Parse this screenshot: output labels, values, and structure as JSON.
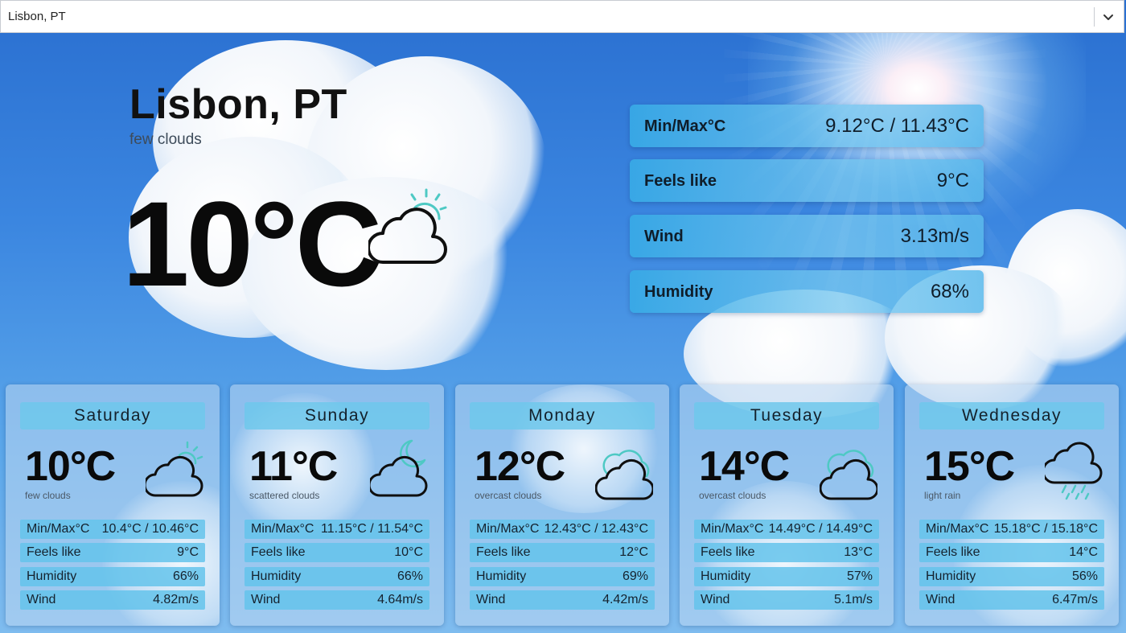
{
  "location_select": {
    "value": "Lisbon, PT"
  },
  "current": {
    "city": "Lisbon, PT",
    "description": "few clouds",
    "temperature": "10°C",
    "icon": "partly-cloudy-day-icon"
  },
  "stats": [
    {
      "label": "Min/Max°C",
      "value": "9.12°C / 11.43°C"
    },
    {
      "label": "Feels like",
      "value": "9°C"
    },
    {
      "label": "Wind",
      "value": "3.13m/s"
    },
    {
      "label": "Humidity",
      "value": "68%"
    }
  ],
  "forecast": [
    {
      "day": "Saturday",
      "temp": "10°C",
      "desc": "few clouds",
      "icon": "partly-cloudy-day-icon",
      "rows": [
        {
          "label": "Min/Max°C",
          "value": "10.4°C / 10.46°C"
        },
        {
          "label": "Feels like",
          "value": "9°C"
        },
        {
          "label": "Humidity",
          "value": "66%"
        },
        {
          "label": "Wind",
          "value": "4.82m/s"
        }
      ]
    },
    {
      "day": "Sunday",
      "temp": "11°C",
      "desc": "scattered clouds",
      "icon": "partly-cloudy-night-icon",
      "rows": [
        {
          "label": "Min/Max°C",
          "value": "11.15°C / 11.54°C"
        },
        {
          "label": "Feels like",
          "value": "10°C"
        },
        {
          "label": "Humidity",
          "value": "66%"
        },
        {
          "label": "Wind",
          "value": "4.64m/s"
        }
      ]
    },
    {
      "day": "Monday",
      "temp": "12°C",
      "desc": "overcast clouds",
      "icon": "overcast-cloud-icon",
      "rows": [
        {
          "label": "Min/Max°C",
          "value": "12.43°C / 12.43°C"
        },
        {
          "label": "Feels like",
          "value": "12°C"
        },
        {
          "label": "Humidity",
          "value": "69%"
        },
        {
          "label": "Wind",
          "value": "4.42m/s"
        }
      ]
    },
    {
      "day": "Tuesday",
      "temp": "14°C",
      "desc": "overcast clouds",
      "icon": "overcast-cloud-icon",
      "rows": [
        {
          "label": "Min/Max°C",
          "value": "14.49°C / 14.49°C"
        },
        {
          "label": "Feels like",
          "value": "13°C"
        },
        {
          "label": "Humidity",
          "value": "57%"
        },
        {
          "label": "Wind",
          "value": "5.1m/s"
        }
      ]
    },
    {
      "day": "Wednesday",
      "temp": "15°C",
      "desc": "light rain",
      "icon": "rain-cloud-icon",
      "rows": [
        {
          "label": "Min/Max°C",
          "value": "15.18°C / 15.18°C"
        },
        {
          "label": "Feels like",
          "value": "14°C"
        },
        {
          "label": "Humidity",
          "value": "56%"
        },
        {
          "label": "Wind",
          "value": "6.47m/s"
        }
      ]
    }
  ],
  "colors": {
    "accent": "#4ec9c4",
    "card_row": "#64c3eb",
    "stat_bar": "#38aae6"
  }
}
